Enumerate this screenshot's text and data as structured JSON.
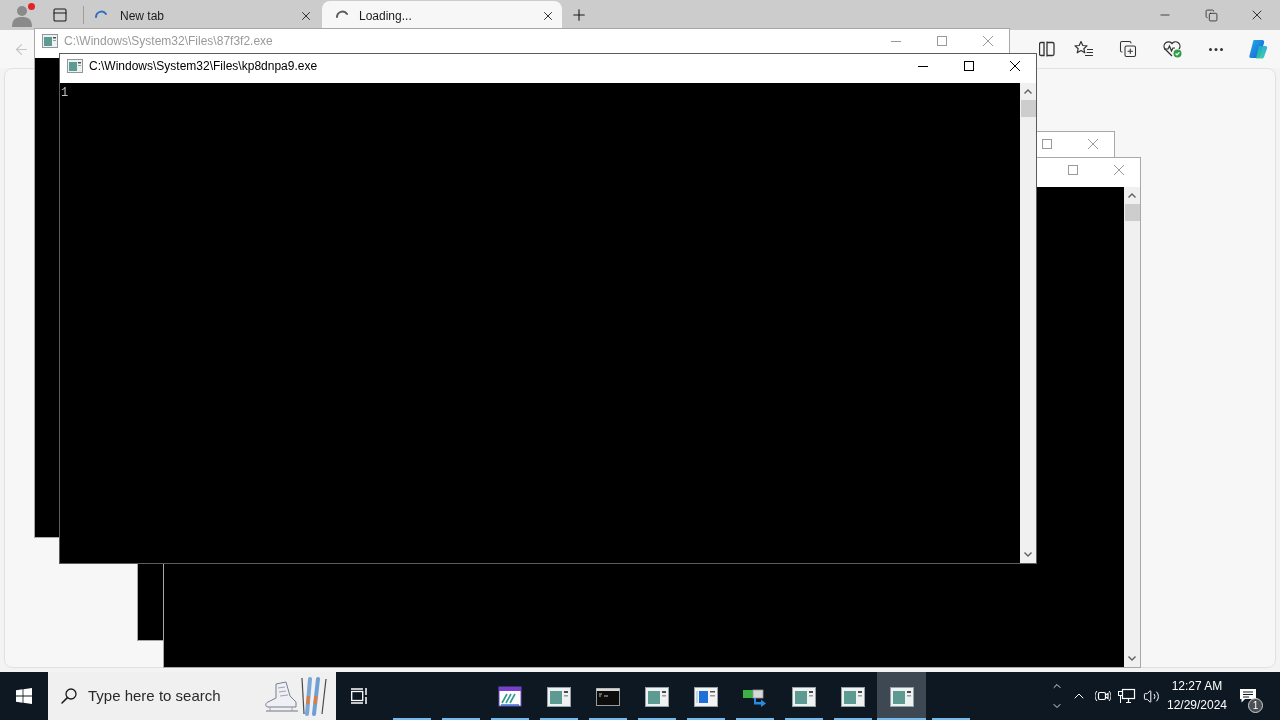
{
  "browser": {
    "tabs": [
      {
        "title": "New tab",
        "selected": false,
        "loading": true
      },
      {
        "title": "Loading...",
        "selected": true,
        "loading": true
      }
    ]
  },
  "windows": [
    {
      "title": "C:\\Windows\\System32\\Files\\87f3f2.exe",
      "active": false
    },
    {
      "title": "C:\\Windows\\System32\\Files\\kp8dnpa9.exe",
      "active": true,
      "output": [
        "1"
      ]
    },
    {
      "active": false
    },
    {
      "active": false
    }
  ],
  "taskbar": {
    "search": {
      "placeholder": "Type here to search"
    },
    "apps": [
      {
        "kind": "blank",
        "selected": false
      },
      {
        "kind": "blank",
        "selected": false
      },
      {
        "kind": "editor",
        "selected": false
      },
      {
        "kind": "console",
        "selected": false
      },
      {
        "kind": "terminal",
        "selected": false
      },
      {
        "kind": "console",
        "selected": false
      },
      {
        "kind": "window",
        "selected": false
      },
      {
        "kind": "transfer",
        "selected": false
      },
      {
        "kind": "console",
        "selected": false
      },
      {
        "kind": "console",
        "selected": false
      },
      {
        "kind": "console",
        "selected": true
      },
      {
        "kind": "blank",
        "selected": false
      }
    ],
    "clock": {
      "time": "12:27 AM",
      "date": "12/29/2024"
    },
    "notifications": {
      "count": "1"
    }
  }
}
